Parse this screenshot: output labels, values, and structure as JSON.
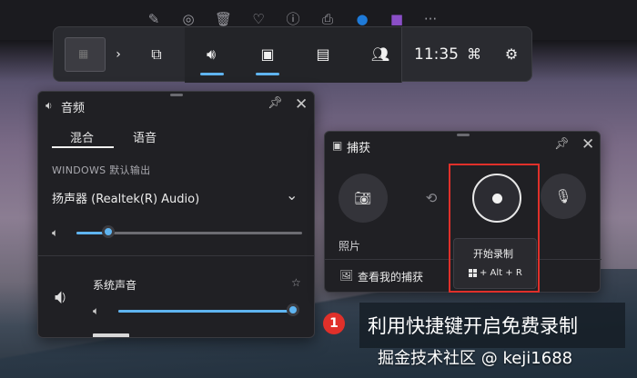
{
  "top_toolbar": {
    "icons": [
      "edit-image-icon",
      "circle-refresh-icon",
      "trash-icon",
      "heart-icon",
      "info-icon",
      "print-icon",
      "edge-icon",
      "app-icon",
      "more-icon"
    ],
    "more_glyph": "···"
  },
  "gamebar": {
    "time": "11:35",
    "items": [
      "widgets-icon",
      "audio-icon",
      "capture-icon",
      "performance-icon",
      "social-icon",
      "mouse-icon",
      "settings-icon"
    ],
    "accent": "#5fb4f0"
  },
  "audio_panel": {
    "title": "音频",
    "tabs": [
      "混合",
      "语音"
    ],
    "active_tab": 0,
    "section_label": "WINDOWS 默认输出",
    "device": "扬声器 (Realtek(R) Audio)",
    "master_volume": 0.14,
    "app_name": "系统声音",
    "app_volume": 1.0
  },
  "capture_panel": {
    "title": "捕获",
    "photo_label": "照片",
    "view_captures": "查看我的捕获",
    "tooltip": {
      "title": "开始录制",
      "shortcut": "+ Alt + R"
    }
  },
  "annotation": {
    "step": "1",
    "caption": "利用快捷键开启免费录制",
    "watermark": "掘金技术社区 @ keji1688",
    "highlight_color": "#e0302a"
  }
}
